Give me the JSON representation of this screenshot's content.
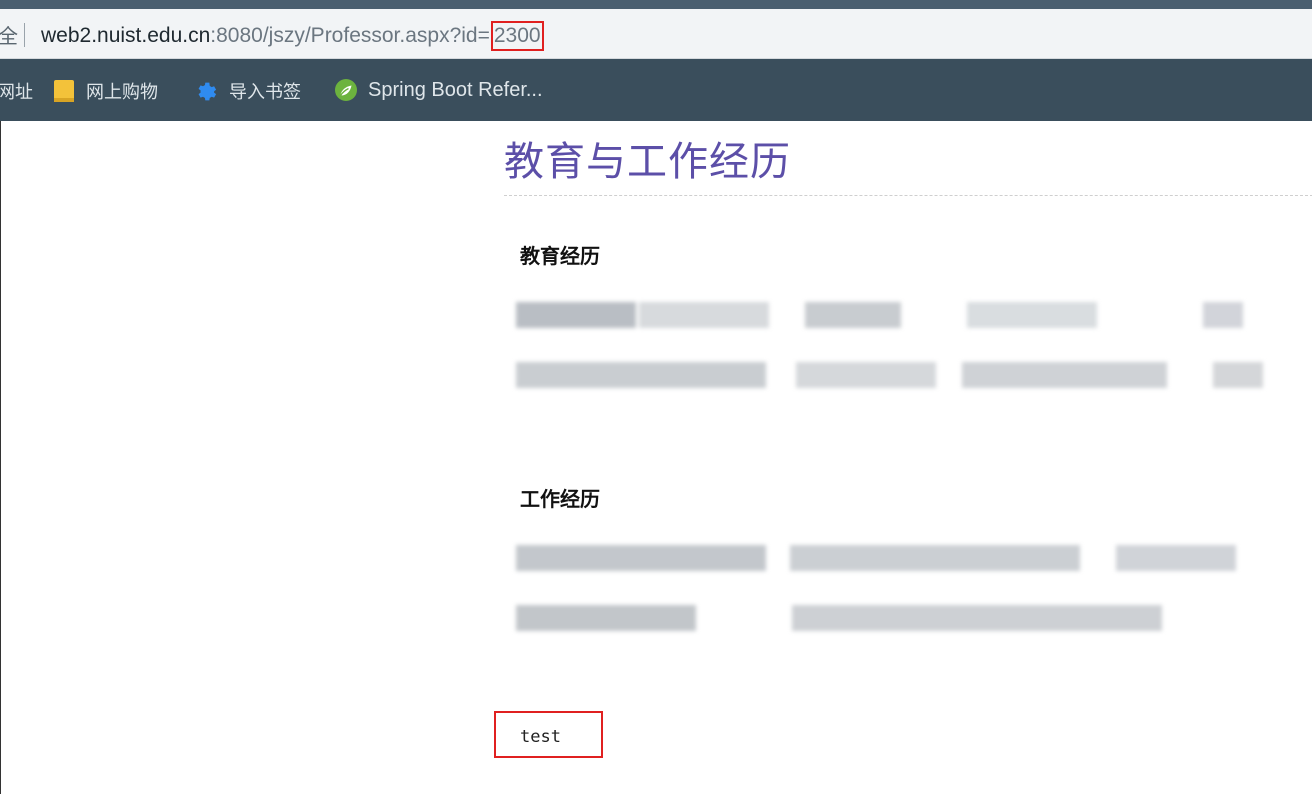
{
  "address_bar": {
    "partial_label": "全",
    "url_domain": "web2.nuist.edu.cn",
    "url_path": ":8080/jszy/Professor.aspx?id=",
    "url_id": "2300"
  },
  "bookmarks": {
    "partial_label": "网址",
    "items": [
      {
        "label": "网上购物",
        "icon": "folder-icon"
      },
      {
        "label": "导入书签",
        "icon": "gear-icon"
      },
      {
        "label": "Spring Boot Refer...",
        "icon": "spring-leaf-icon"
      }
    ]
  },
  "content": {
    "title": "教育与工作经历",
    "education_heading": "教育经历",
    "work_heading": "工作经历",
    "test_text": "test"
  },
  "colors": {
    "title": "#5c4fa8",
    "highlight_box": "#e02020",
    "bookmark_bar": "#3a4e5c",
    "address_bar": "#f2f4f6"
  }
}
